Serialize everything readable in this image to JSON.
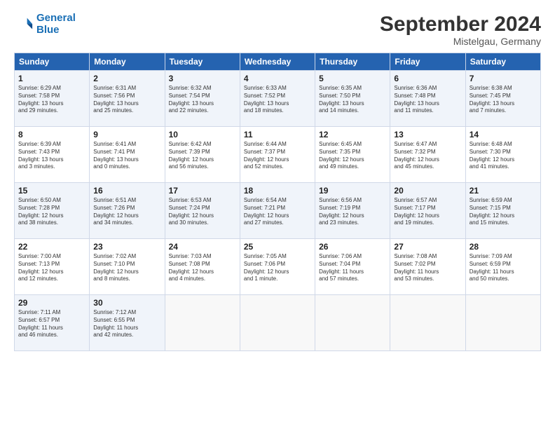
{
  "header": {
    "logo_line1": "General",
    "logo_line2": "Blue",
    "month": "September 2024",
    "location": "Mistelgau, Germany"
  },
  "days_of_week": [
    "Sunday",
    "Monday",
    "Tuesday",
    "Wednesday",
    "Thursday",
    "Friday",
    "Saturday"
  ],
  "weeks": [
    [
      {
        "day": "1",
        "lines": [
          "Sunrise: 6:29 AM",
          "Sunset: 7:58 PM",
          "Daylight: 13 hours",
          "and 29 minutes."
        ]
      },
      {
        "day": "2",
        "lines": [
          "Sunrise: 6:31 AM",
          "Sunset: 7:56 PM",
          "Daylight: 13 hours",
          "and 25 minutes."
        ]
      },
      {
        "day": "3",
        "lines": [
          "Sunrise: 6:32 AM",
          "Sunset: 7:54 PM",
          "Daylight: 13 hours",
          "and 22 minutes."
        ]
      },
      {
        "day": "4",
        "lines": [
          "Sunrise: 6:33 AM",
          "Sunset: 7:52 PM",
          "Daylight: 13 hours",
          "and 18 minutes."
        ]
      },
      {
        "day": "5",
        "lines": [
          "Sunrise: 6:35 AM",
          "Sunset: 7:50 PM",
          "Daylight: 13 hours",
          "and 14 minutes."
        ]
      },
      {
        "day": "6",
        "lines": [
          "Sunrise: 6:36 AM",
          "Sunset: 7:48 PM",
          "Daylight: 13 hours",
          "and 11 minutes."
        ]
      },
      {
        "day": "7",
        "lines": [
          "Sunrise: 6:38 AM",
          "Sunset: 7:45 PM",
          "Daylight: 13 hours",
          "and 7 minutes."
        ]
      }
    ],
    [
      {
        "day": "8",
        "lines": [
          "Sunrise: 6:39 AM",
          "Sunset: 7:43 PM",
          "Daylight: 13 hours",
          "and 3 minutes."
        ]
      },
      {
        "day": "9",
        "lines": [
          "Sunrise: 6:41 AM",
          "Sunset: 7:41 PM",
          "Daylight: 13 hours",
          "and 0 minutes."
        ]
      },
      {
        "day": "10",
        "lines": [
          "Sunrise: 6:42 AM",
          "Sunset: 7:39 PM",
          "Daylight: 12 hours",
          "and 56 minutes."
        ]
      },
      {
        "day": "11",
        "lines": [
          "Sunrise: 6:44 AM",
          "Sunset: 7:37 PM",
          "Daylight: 12 hours",
          "and 52 minutes."
        ]
      },
      {
        "day": "12",
        "lines": [
          "Sunrise: 6:45 AM",
          "Sunset: 7:35 PM",
          "Daylight: 12 hours",
          "and 49 minutes."
        ]
      },
      {
        "day": "13",
        "lines": [
          "Sunrise: 6:47 AM",
          "Sunset: 7:32 PM",
          "Daylight: 12 hours",
          "and 45 minutes."
        ]
      },
      {
        "day": "14",
        "lines": [
          "Sunrise: 6:48 AM",
          "Sunset: 7:30 PM",
          "Daylight: 12 hours",
          "and 41 minutes."
        ]
      }
    ],
    [
      {
        "day": "15",
        "lines": [
          "Sunrise: 6:50 AM",
          "Sunset: 7:28 PM",
          "Daylight: 12 hours",
          "and 38 minutes."
        ]
      },
      {
        "day": "16",
        "lines": [
          "Sunrise: 6:51 AM",
          "Sunset: 7:26 PM",
          "Daylight: 12 hours",
          "and 34 minutes."
        ]
      },
      {
        "day": "17",
        "lines": [
          "Sunrise: 6:53 AM",
          "Sunset: 7:24 PM",
          "Daylight: 12 hours",
          "and 30 minutes."
        ]
      },
      {
        "day": "18",
        "lines": [
          "Sunrise: 6:54 AM",
          "Sunset: 7:21 PM",
          "Daylight: 12 hours",
          "and 27 minutes."
        ]
      },
      {
        "day": "19",
        "lines": [
          "Sunrise: 6:56 AM",
          "Sunset: 7:19 PM",
          "Daylight: 12 hours",
          "and 23 minutes."
        ]
      },
      {
        "day": "20",
        "lines": [
          "Sunrise: 6:57 AM",
          "Sunset: 7:17 PM",
          "Daylight: 12 hours",
          "and 19 minutes."
        ]
      },
      {
        "day": "21",
        "lines": [
          "Sunrise: 6:59 AM",
          "Sunset: 7:15 PM",
          "Daylight: 12 hours",
          "and 15 minutes."
        ]
      }
    ],
    [
      {
        "day": "22",
        "lines": [
          "Sunrise: 7:00 AM",
          "Sunset: 7:13 PM",
          "Daylight: 12 hours",
          "and 12 minutes."
        ]
      },
      {
        "day": "23",
        "lines": [
          "Sunrise: 7:02 AM",
          "Sunset: 7:10 PM",
          "Daylight: 12 hours",
          "and 8 minutes."
        ]
      },
      {
        "day": "24",
        "lines": [
          "Sunrise: 7:03 AM",
          "Sunset: 7:08 PM",
          "Daylight: 12 hours",
          "and 4 minutes."
        ]
      },
      {
        "day": "25",
        "lines": [
          "Sunrise: 7:05 AM",
          "Sunset: 7:06 PM",
          "Daylight: 12 hours",
          "and 1 minute."
        ]
      },
      {
        "day": "26",
        "lines": [
          "Sunrise: 7:06 AM",
          "Sunset: 7:04 PM",
          "Daylight: 11 hours",
          "and 57 minutes."
        ]
      },
      {
        "day": "27",
        "lines": [
          "Sunrise: 7:08 AM",
          "Sunset: 7:02 PM",
          "Daylight: 11 hours",
          "and 53 minutes."
        ]
      },
      {
        "day": "28",
        "lines": [
          "Sunrise: 7:09 AM",
          "Sunset: 6:59 PM",
          "Daylight: 11 hours",
          "and 50 minutes."
        ]
      }
    ],
    [
      {
        "day": "29",
        "lines": [
          "Sunrise: 7:11 AM",
          "Sunset: 6:57 PM",
          "Daylight: 11 hours",
          "and 46 minutes."
        ]
      },
      {
        "day": "30",
        "lines": [
          "Sunrise: 7:12 AM",
          "Sunset: 6:55 PM",
          "Daylight: 11 hours",
          "and 42 minutes."
        ]
      },
      {
        "day": "",
        "lines": []
      },
      {
        "day": "",
        "lines": []
      },
      {
        "day": "",
        "lines": []
      },
      {
        "day": "",
        "lines": []
      },
      {
        "day": "",
        "lines": []
      }
    ]
  ]
}
